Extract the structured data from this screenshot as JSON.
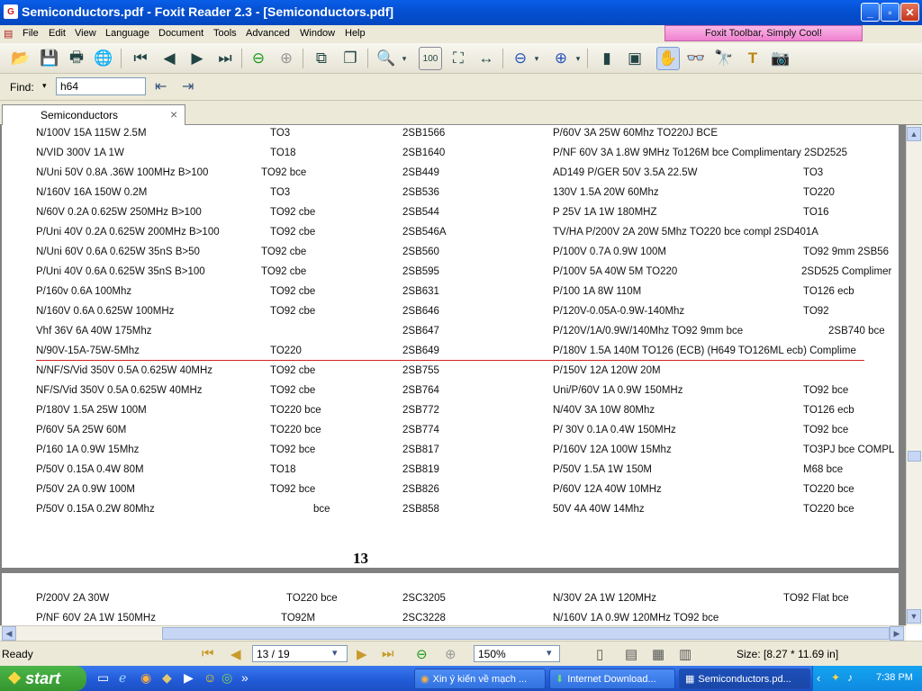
{
  "window": {
    "icon_letter": "G",
    "title": "Semiconductors.pdf - Foxit Reader 2.3 - [Semiconductors.pdf]",
    "min": "_",
    "max": "▫",
    "close": "✕"
  },
  "menu": [
    "File",
    "Edit",
    "View",
    "Language",
    "Document",
    "Tools",
    "Advanced",
    "Window",
    "Help"
  ],
  "banner": "Foxit Toolbar, Simply Cool!",
  "find": {
    "label": "Find:",
    "value": "h64"
  },
  "tab": {
    "label": "Semiconductors",
    "close": "×"
  },
  "rows": [
    [
      "N/100V 15A 115W 2.5M",
      "TO3",
      "2SB1566",
      "P/60V 3A 25W 60Mhz TO220J BCE",
      ""
    ],
    [
      "N/VID 300V 1A 1W",
      "TO18",
      "2SB1640",
      "P/NF 60V 3A 1.8W 9MHz To126M bce  Complimentary 2SD2525",
      ""
    ],
    [
      "N/Uni 50V 0.8A .36W 100MHz B>100",
      "TO92 bce",
      "2SB449",
      "AD149 P/GER 50V 3.5A 22.5W",
      "TO3"
    ],
    [
      "N/160V 16A 150W 0.2M",
      "TO3",
      "2SB536",
      "130V 1.5A 20W 60Mhz",
      "TO220"
    ],
    [
      "N/60V 0.2A 0.625W 250MHz B>100",
      "TO92 cbe",
      "2SB544",
      "P 25V 1A 1W 180MHZ",
      "TO16"
    ],
    [
      "P/Uni 40V 0.2A 0.625W 200MHz B>100",
      "TO92 cbe",
      "2SB546A",
      "TV/HA  P/200V 2A 20W 5Mhz TO220 bce compl 2SD401A",
      ""
    ],
    [
      "N/Uni 60V 0.6A 0.625W 35nS B>50",
      "TO92 cbe",
      "2SB560",
      "P/100V 0.7A 0.9W 100M",
      "TO92 9mm  2SB56"
    ],
    [
      "P/Uni 40V 0.6A 0.625W 35nS B>100",
      "TO92 cbe",
      "2SB595",
      "P/100V 5A 40W 5M                TO220",
      "2SD525 Complimer"
    ],
    [
      "P/160v 0.6A 100Mhz",
      "TO92  cbe",
      "2SB631",
      "P/100 1A 8W 110M",
      "TO126  ecb"
    ],
    [
      "N/160V 0.6A 0.625W 100MHz",
      "TO92 cbe",
      "2SB646",
      "P/120V-0.05A-0.9W-140Mhz",
      "TO92"
    ],
    [
      "Vhf 36V 6A 40W 175Mhz",
      "",
      "2SB647",
      "P/120V/1A/0.9W/140Mhz      TO92   9mm     bce",
      "2SB740 bce"
    ],
    [
      "N/90V-15A-75W-5Mhz",
      "TO220",
      "2SB649",
      "P/180V 1.5A 140M      TO126 (ECB)  (H649 TO126ML  ecb)  Complime",
      ""
    ],
    [
      "N/NF/S/Vid 350V 0.5A 0.625W 40MHz",
      "TO92 cbe",
      "2SB755",
      "P/150V 12A 120W 20M",
      ""
    ],
    [
      "NF/S/Vid  350V 0.5A 0.625W 40MHz",
      "TO92   cbe",
      "2SB764",
      "Uni/P/60V 1A 0.9W 150MHz",
      "TO92  bce"
    ],
    [
      "P/180V 1.5A  25W 100M",
      "TO220 bce",
      "2SB772",
      "N/40V 3A 10W 80Mhz",
      "TO126  ecb"
    ],
    [
      "P/60V 5A 25W 60M",
      "TO220 bce",
      "2SB774",
      "P/  30V 0.1A 0.4W 150MHz",
      "TO92 bce"
    ],
    [
      "P/160 1A 0.9W 15Mhz",
      "TO92 bce",
      "2SB817",
      "P/160V 12A 100W 15Mhz",
      "TO3PJ bce COMPL"
    ],
    [
      "P/50V 0.15A 0.4W 80M",
      "TO18",
      "2SB819",
      "P/50V 1.5A 1W 150M",
      "M68 bce"
    ],
    [
      "P/50V 2A 0.9W 100M",
      "TO92 bce",
      "2SB826",
      "P/60V 12A 40W 10MHz",
      "TO220 bce"
    ],
    [
      "P/50V 0.15A 0.2W 80Mhz",
      "bce",
      "2SB858",
      "50V 4A 40W 14Mhz",
      "TO220  bce"
    ]
  ],
  "page_number": "13",
  "rows2": [
    [
      "P/200V 2A 30W",
      "TO220  bce",
      "2SC3205",
      "N/30V 2A 1W 120MHz",
      "TO92 Flat         bce"
    ],
    [
      "P/NF  60V 2A 1W 150MHz",
      "TO92M",
      "2SC3228",
      "N/160V 1A 0.9W 120MHz TO92 bce",
      ""
    ]
  ],
  "status": {
    "ready": "Ready",
    "page": "13 / 19",
    "zoom": "150%",
    "size": "Size: [8.27 * 11.69 in]"
  },
  "taskbar": {
    "start": "start",
    "tasks": [
      "Xin ý kiến về mạch ...",
      "Internet Download...",
      "Semiconductors.pd..."
    ],
    "time": "7:38 PM"
  }
}
